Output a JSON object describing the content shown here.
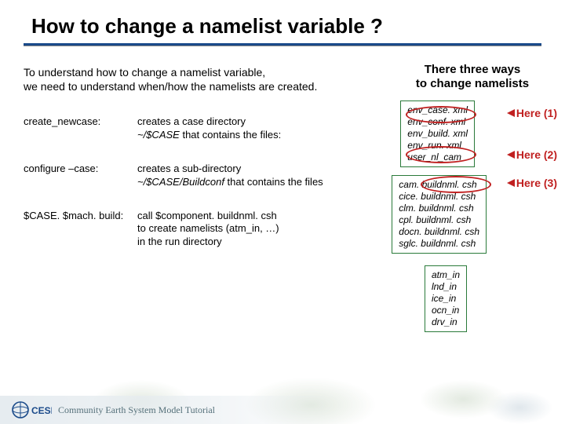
{
  "title": "How to change a namelist variable ?",
  "intro": {
    "line1": "To understand how to change a namelist variable,",
    "line2": "we need to understand when/how the namelists are created."
  },
  "tagline": {
    "line1": "There three ways",
    "line2": "to change namelists"
  },
  "steps": [
    {
      "label": "create_newcase:",
      "desc_plain": "creates a case directory",
      "desc_ital": "~/$CASE",
      "desc_tail": " that contains the files:"
    },
    {
      "label": "configure –case:",
      "desc_plain": "creates a sub-directory",
      "desc_ital": "~/$CASE/Buildconf",
      "desc_tail": " that contains the files"
    },
    {
      "label": "$CASE. $mach. build:",
      "desc_l1": "call $component. buildnml. csh",
      "desc_l2": "to create namelists (atm_in, …)",
      "desc_l3": "in the run directory"
    }
  ],
  "boxes": {
    "env": [
      "env_case. xml",
      "env_conf. xml",
      "env_build. xml",
      "env_run. xml",
      "user_nl_cam"
    ],
    "buildnml": [
      "cam. buildnml. csh",
      "cice. buildnml. csh",
      "clm. buildnml. csh",
      "cpl. buildnml. csh",
      "docn. buildnml. csh",
      "sglc. buildnml. csh"
    ],
    "namelists": [
      "atm_in",
      "lnd_in",
      "ice_in",
      "ocn_in",
      "drv_in"
    ]
  },
  "here": {
    "h1": "Here (1)",
    "h2": "Here (2)",
    "h3": "Here (3)"
  },
  "footer": {
    "logo_text": "CESM",
    "text": "Community Earth System Model Tutorial"
  }
}
